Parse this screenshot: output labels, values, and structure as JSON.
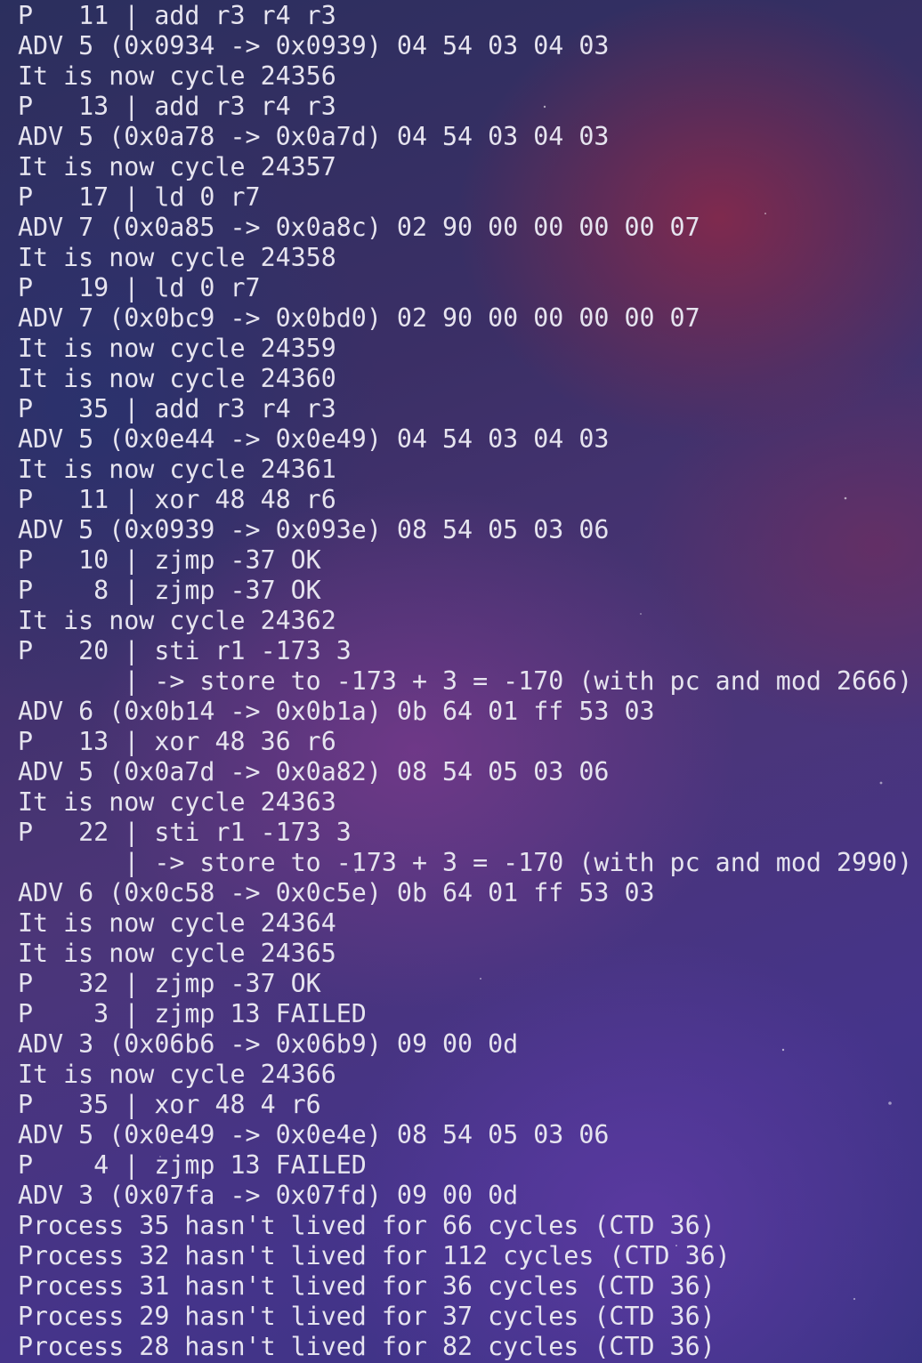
{
  "terminal": {
    "lines": [
      "P   11 | add r3 r4 r3",
      "ADV 5 (0x0934 -> 0x0939) 04 54 03 04 03",
      "It is now cycle 24356",
      "P   13 | add r3 r4 r3",
      "ADV 5 (0x0a78 -> 0x0a7d) 04 54 03 04 03",
      "It is now cycle 24357",
      "P   17 | ld 0 r7",
      "ADV 7 (0x0a85 -> 0x0a8c) 02 90 00 00 00 00 07",
      "It is now cycle 24358",
      "P   19 | ld 0 r7",
      "ADV 7 (0x0bc9 -> 0x0bd0) 02 90 00 00 00 00 07",
      "It is now cycle 24359",
      "It is now cycle 24360",
      "P   35 | add r3 r4 r3",
      "ADV 5 (0x0e44 -> 0x0e49) 04 54 03 04 03",
      "It is now cycle 24361",
      "P   11 | xor 48 48 r6",
      "ADV 5 (0x0939 -> 0x093e) 08 54 05 03 06",
      "P   10 | zjmp -37 OK",
      "P    8 | zjmp -37 OK",
      "It is now cycle 24362",
      "P   20 | sti r1 -173 3",
      "       | -> store to -173 + 3 = -170 (with pc and mod 2666)",
      "ADV 6 (0x0b14 -> 0x0b1a) 0b 64 01 ff 53 03",
      "P   13 | xor 48 36 r6",
      "ADV 5 (0x0a7d -> 0x0a82) 08 54 05 03 06",
      "It is now cycle 24363",
      "P   22 | sti r1 -173 3",
      "       | -> store to -173 + 3 = -170 (with pc and mod 2990)",
      "ADV 6 (0x0c58 -> 0x0c5e) 0b 64 01 ff 53 03",
      "It is now cycle 24364",
      "It is now cycle 24365",
      "P   32 | zjmp -37 OK",
      "P    3 | zjmp 13 FAILED",
      "ADV 3 (0x06b6 -> 0x06b9) 09 00 0d",
      "It is now cycle 24366",
      "P   35 | xor 48 4 r6",
      "ADV 5 (0x0e49 -> 0x0e4e) 08 54 05 03 06",
      "P    4 | zjmp 13 FAILED",
      "ADV 3 (0x07fa -> 0x07fd) 09 00 0d",
      "Process 35 hasn't lived for 66 cycles (CTD 36)",
      "Process 32 hasn't lived for 112 cycles (CTD 36)",
      "Process 31 hasn't lived for 36 cycles (CTD 36)",
      "Process 29 hasn't lived for 37 cycles (CTD 36)",
      "Process 28 hasn't lived for 82 cycles (CTD 36)"
    ]
  }
}
